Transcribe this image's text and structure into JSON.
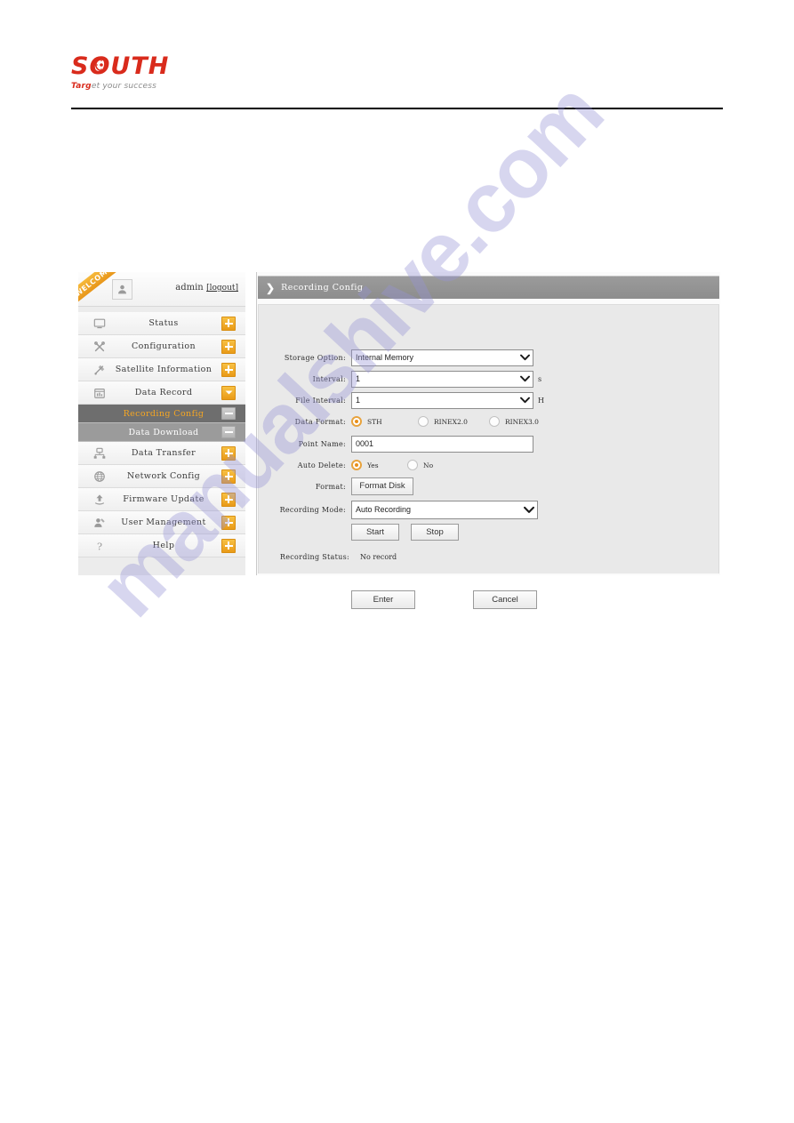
{
  "header": {
    "logo_text": "SOUTH",
    "logo_tagline_accent": "Targ",
    "logo_tagline_rest": "et your success",
    "logo_color": "#d92b1c"
  },
  "watermark": {
    "text": "manualshive.com",
    "color": "#9694d6"
  },
  "sidebar": {
    "welcome_ribbon": "WELCOME",
    "user_name": "admin",
    "logout_label": "[logout]",
    "items": [
      {
        "label": "Status",
        "icon": "monitor-icon",
        "toggle": "plus",
        "state": "normal"
      },
      {
        "label": "Configuration",
        "icon": "wrench-icon",
        "toggle": "plus",
        "state": "normal"
      },
      {
        "label": "Satellite Information",
        "icon": "satellite-icon",
        "toggle": "plus",
        "state": "normal"
      },
      {
        "label": "Data Record",
        "icon": "calendar-chart-icon",
        "toggle": "minus-down",
        "state": "normal"
      }
    ],
    "sub_items": [
      {
        "label": "Recording Config",
        "toggle": "minus",
        "state": "selected"
      },
      {
        "label": "Data Download",
        "toggle": "minus",
        "state": "normal"
      }
    ],
    "items_after": [
      {
        "label": "Data Transfer",
        "icon": "network-node-icon",
        "toggle": "plus",
        "state": "normal"
      },
      {
        "label": "Network Config",
        "icon": "globe-icon",
        "toggle": "plus",
        "state": "normal"
      },
      {
        "label": "Firmware Update",
        "icon": "upload-icon",
        "toggle": "plus",
        "state": "normal"
      },
      {
        "label": "User Management",
        "icon": "user-key-icon",
        "toggle": "plus",
        "state": "normal"
      },
      {
        "label": "Help",
        "icon": "question-mark-icon",
        "toggle": "plus",
        "state": "normal"
      }
    ],
    "accent_color": "#f5a623",
    "selected_bg": "#6e6e6e"
  },
  "panel": {
    "title": "Recording Config",
    "header_bg": "#929292"
  },
  "form": {
    "storage_option": {
      "label": "Storage Option:",
      "value": "Internal Memory"
    },
    "interval": {
      "label": "Interval:",
      "value": "1",
      "unit": "s"
    },
    "file_interval": {
      "label": "File Interval:",
      "value": "1",
      "unit": "H"
    },
    "data_format": {
      "label": "Data Format:",
      "options": [
        {
          "label": "STH",
          "selected": true
        },
        {
          "label": "RINEX2.0",
          "selected": false
        },
        {
          "label": "RINEX3.0",
          "selected": false
        }
      ]
    },
    "point_name": {
      "label": "Point Name:",
      "value": "0001"
    },
    "auto_delete": {
      "label": "Auto Delete:",
      "options": [
        {
          "label": "Yes",
          "selected": true
        },
        {
          "label": "No",
          "selected": false
        }
      ]
    },
    "format": {
      "label": "Format:",
      "button_label": "Format Disk"
    },
    "recording_mode": {
      "label": "Recording Mode:",
      "value": "Auto Recording"
    },
    "start_label": "Start",
    "stop_label": "Stop",
    "recording_status": {
      "label": "Recording Status:",
      "value": "No record"
    },
    "enter_label": "Enter",
    "cancel_label": "Cancel"
  }
}
